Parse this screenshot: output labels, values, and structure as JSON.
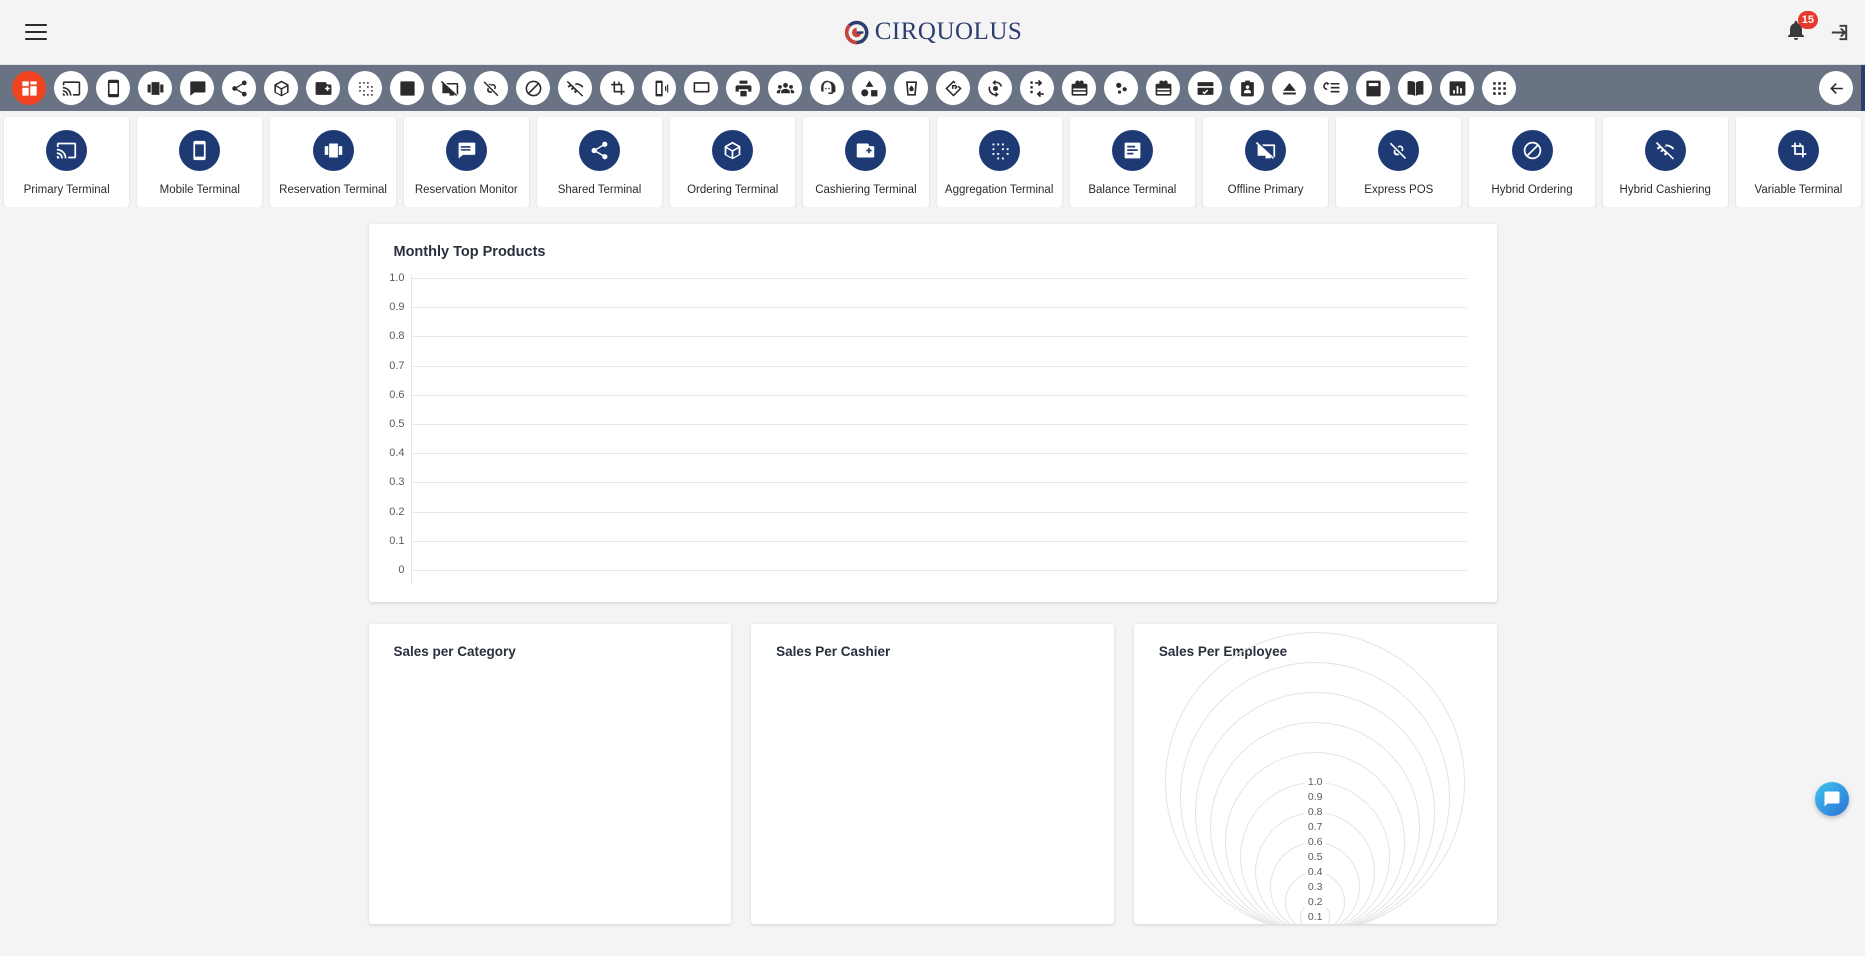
{
  "header": {
    "menu_label": "Menu",
    "brand_text": "CIRQUOLUS",
    "notification_count": "15",
    "logout_label": "Logout"
  },
  "toolbar": {
    "icons": [
      {
        "name": "dashboard-icon",
        "active": true
      },
      {
        "name": "cast-icon",
        "active": false
      },
      {
        "name": "smartphone-icon",
        "active": false
      },
      {
        "name": "view-carousel-icon",
        "active": false
      },
      {
        "name": "list-alt-icon",
        "active": false
      },
      {
        "name": "share-icon",
        "active": false
      },
      {
        "name": "3d-rotation-icon",
        "active": false
      },
      {
        "name": "add-photo-icon",
        "active": false
      },
      {
        "name": "scatter-shuffle-icon",
        "active": false
      },
      {
        "name": "article-icon",
        "active": false
      },
      {
        "name": "tv-off-icon",
        "active": false
      },
      {
        "name": "link-off-icon",
        "active": false
      },
      {
        "name": "block-icon",
        "active": false
      },
      {
        "name": "wifi-off-icon",
        "active": false
      },
      {
        "name": "crop-rotate-icon",
        "active": false
      },
      {
        "name": "vibration-icon",
        "active": false
      },
      {
        "name": "desktop-icon",
        "active": false
      },
      {
        "name": "print-icon",
        "active": false
      },
      {
        "name": "groups-icon",
        "active": false
      },
      {
        "name": "support-agent-icon",
        "active": false
      },
      {
        "name": "category-icon",
        "active": false
      },
      {
        "name": "drink-icon",
        "active": false
      },
      {
        "name": "directions-icon",
        "active": false
      },
      {
        "name": "flip-camera-icon",
        "active": false
      },
      {
        "name": "drive-transfer-icon",
        "active": false
      },
      {
        "name": "card-giftcard-icon",
        "active": false
      },
      {
        "name": "bubble-chart-icon",
        "active": false
      },
      {
        "name": "gift-icon",
        "active": false
      },
      {
        "name": "payment-check-icon",
        "active": false
      },
      {
        "name": "badge-id-icon",
        "active": false
      },
      {
        "name": "eject-icon",
        "active": false
      },
      {
        "name": "queue-playlist-icon",
        "active": false
      },
      {
        "name": "calculate-icon",
        "active": false
      },
      {
        "name": "menu-book-icon",
        "active": false
      },
      {
        "name": "bar-chart-icon",
        "active": false
      },
      {
        "name": "apps-grid-icon",
        "active": false
      }
    ],
    "back_label": "Back"
  },
  "shortcuts": [
    {
      "label": "Primary Terminal",
      "icon": "cast-icon"
    },
    {
      "label": "Mobile Terminal",
      "icon": "smartphone-icon"
    },
    {
      "label": "Reservation Terminal",
      "icon": "view-carousel-icon"
    },
    {
      "label": "Reservation Monitor",
      "icon": "list-alt-icon"
    },
    {
      "label": "Shared Terminal",
      "icon": "share-icon"
    },
    {
      "label": "Ordering Terminal",
      "icon": "3d-rotation-icon"
    },
    {
      "label": "Cashiering Terminal",
      "icon": "add-photo-icon"
    },
    {
      "label": "Aggregation Terminal",
      "icon": "scatter-shuffle-icon"
    },
    {
      "label": "Balance Terminal",
      "icon": "article-icon"
    },
    {
      "label": "Offline Primary",
      "icon": "tv-off-icon"
    },
    {
      "label": "Express POS",
      "icon": "link-off-icon"
    },
    {
      "label": "Hybrid Ordering",
      "icon": "block-icon"
    },
    {
      "label": "Hybrid Cashiering",
      "icon": "wifi-off-icon"
    },
    {
      "label": "Variable Terminal",
      "icon": "crop-rotate-icon"
    }
  ],
  "main": {
    "top_chart_title": "Monthly Top Products",
    "cards": [
      {
        "title": "Sales per Category"
      },
      {
        "title": "Sales Per Cashier"
      },
      {
        "title": "Sales Per Employee"
      }
    ]
  },
  "chart_data": [
    {
      "type": "bar",
      "title": "Monthly Top Products",
      "categories": [],
      "values": [],
      "xlabel": "",
      "ylabel": "",
      "ylim": [
        0,
        1.0
      ],
      "yticks": [
        "1.0",
        "0.9",
        "0.8",
        "0.7",
        "0.6",
        "0.5",
        "0.4",
        "0.3",
        "0.2",
        "0.1",
        "0"
      ],
      "grid": true,
      "legend": "none",
      "note": "empty - no data series rendered"
    },
    {
      "type": "pie",
      "title": "Sales per Category",
      "categories": [],
      "values": [],
      "note": "empty - no data series rendered"
    },
    {
      "type": "pie",
      "title": "Sales Per Cashier",
      "categories": [],
      "values": [],
      "note": "empty - no data series rendered"
    },
    {
      "type": "radar",
      "title": "Sales Per Employee",
      "categories": [],
      "values": [],
      "ylim": [
        0,
        1.0
      ],
      "yticks": [
        "1.0",
        "0.9",
        "0.8",
        "0.7",
        "0.6",
        "0.5",
        "0.4",
        "0.3",
        "0.2",
        "0.1"
      ],
      "grid": true,
      "note": "empty - only radial gridlines rendered"
    }
  ],
  "colors": {
    "accent_red": "#f04322",
    "brand_navy": "#2d3e6e",
    "tile_navy": "#1e3a75",
    "toolbar_gray": "#6a7383",
    "badge_red": "#e8392c"
  },
  "chat": {
    "label": "Chat assistant"
  }
}
